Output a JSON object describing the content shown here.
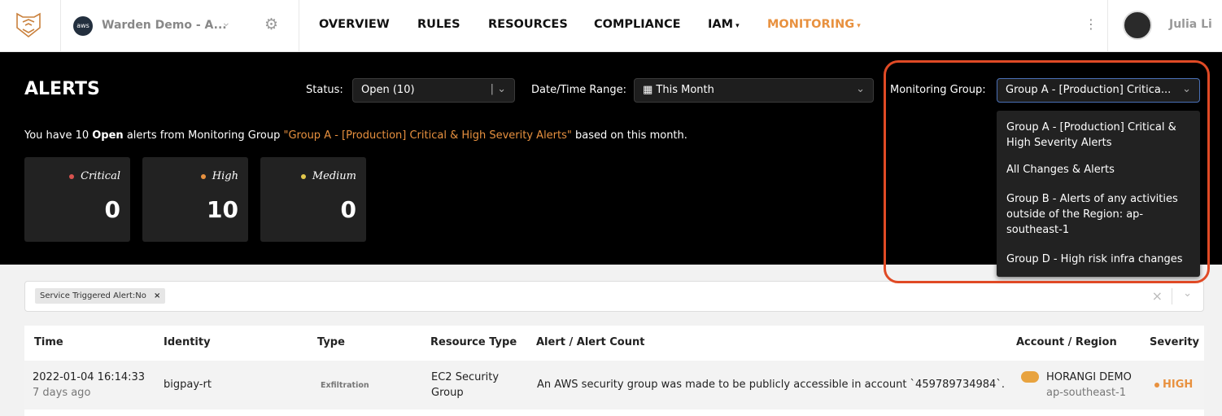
{
  "nav": {
    "account": "Warden Demo - A...",
    "items": [
      "OVERVIEW",
      "RULES",
      "RESOURCES",
      "COMPLIANCE",
      "IAM",
      "MONITORING"
    ],
    "user": "Julia Li",
    "accent": "#e8913f"
  },
  "hero": {
    "title": "ALERTS",
    "status_label": "Status:",
    "status_value": "Open (10)",
    "date_label": "Date/Time Range:",
    "date_value": "This Month",
    "group_label": "Monitoring Group:",
    "group_value": "Group A - [Production] Critica...",
    "summary": {
      "pre": "You have 10 ",
      "open": "Open",
      "mid": " alerts from Monitoring Group ",
      "group": "\"Group A - [Production] Critical & High Severity Alerts\"",
      "post": " based on this month."
    },
    "cards": [
      {
        "label": "Critical",
        "value": "0",
        "color": "#d9534f"
      },
      {
        "label": "High",
        "value": "10",
        "color": "#e8913f"
      },
      {
        "label": "Medium",
        "value": "0",
        "color": "#e3c84c"
      }
    ]
  },
  "menu": {
    "options": [
      "Group A - [Production] Critical & High Severity Alerts",
      "All Changes & Alerts",
      "Group B - Alerts of any activities outside of the Region: ap-southeast-1",
      "Group D - High risk infra changes"
    ]
  },
  "filter": {
    "chip": "Service Triggered Alert:No"
  },
  "table": {
    "headers": [
      "Time",
      "Identity",
      "Type",
      "Resource Type",
      "Alert / Alert Count",
      "Account / Region",
      "Severity"
    ],
    "rows": [
      {
        "time": "2022-01-04 16:14:33",
        "ago": "7 days ago",
        "identity": "bigpay-rt",
        "type": "Exfiltration",
        "resource": "EC2 Security Group",
        "alert": "An AWS security group was made to be publicly accessible in account `459789734984`.",
        "account": "HORANGI DEMO",
        "region": "ap-southeast-1",
        "severity": "HIGH"
      }
    ]
  }
}
